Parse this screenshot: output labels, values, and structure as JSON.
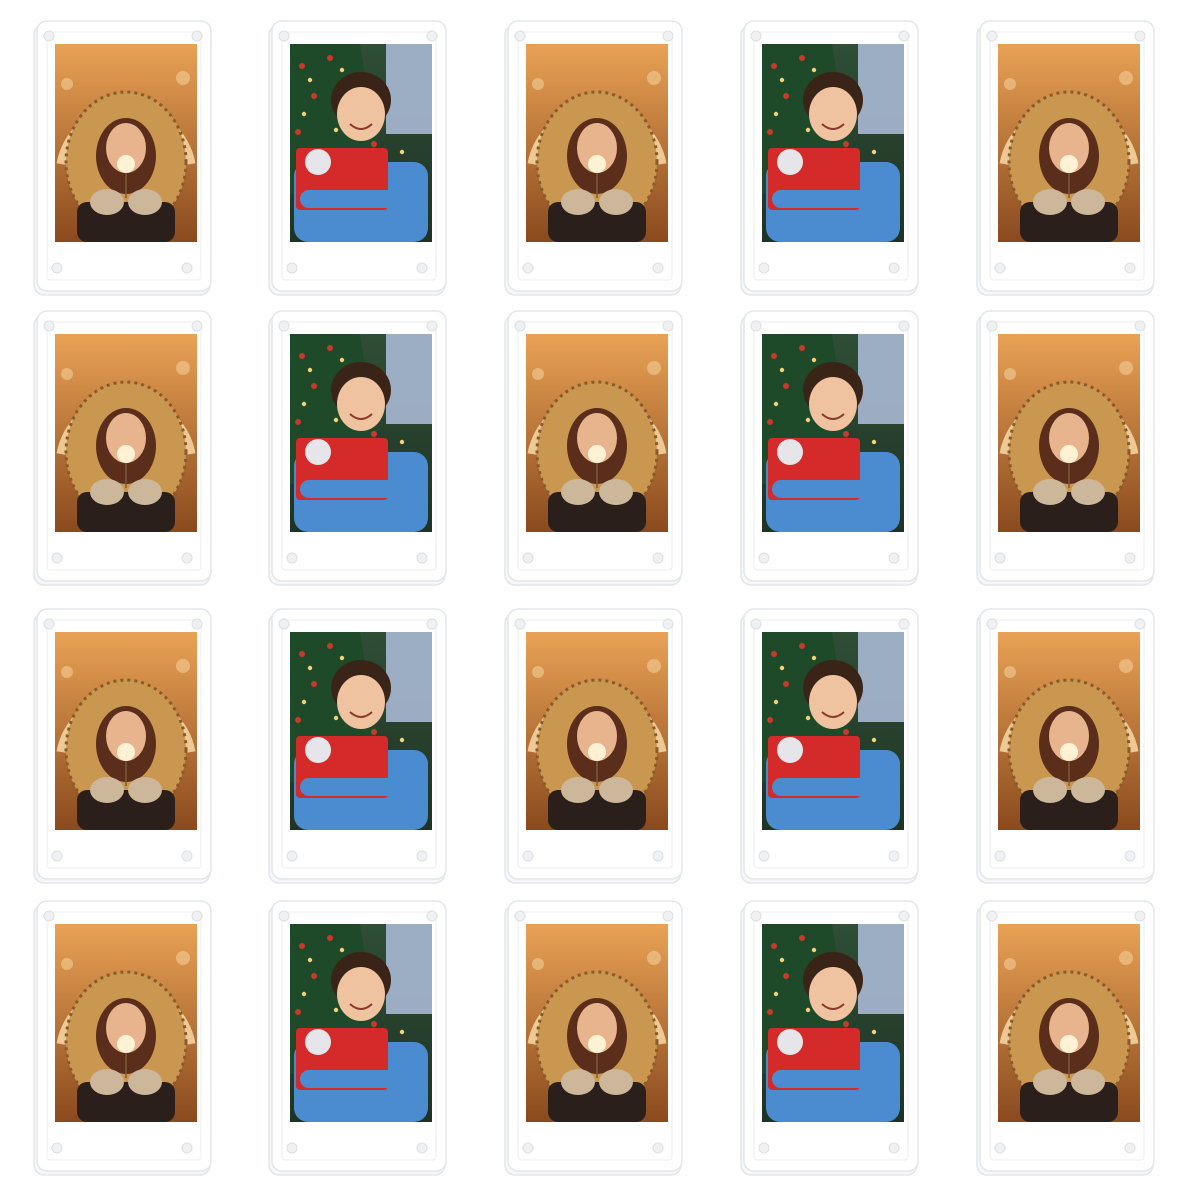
{
  "grid": {
    "rows": 4,
    "columns": 5
  },
  "colors": {
    "acrylic_edge": "#e3e6ea",
    "insert_paper": "#ffffff",
    "magnet_dot": "#f0f1f3"
  },
  "photo_pattern": [
    "girl-in-fur-hood",
    "boy-with-gift",
    "girl-in-fur-hood",
    "boy-with-gift",
    "girl-in-fur-hood"
  ],
  "photos": {
    "girl-in-fur-hood": {
      "subject": "girl-in-fur-hood",
      "colors": {
        "bg_top": "#e9a255",
        "bg_bottom": "#8a4a1e",
        "arch": "#f7d9a6",
        "fur": "#c9974f",
        "fur_dark": "#8a5a2a",
        "face": "#e8b48e",
        "hair": "#5a2e1a",
        "coat": "#2b1f1c",
        "mittens": "#cdb79a",
        "sparkler": "#fff6d8"
      }
    },
    "boy-with-gift": {
      "subject": "boy-with-gift",
      "colors": {
        "bg_top": "#2f4e36",
        "bg_bottom": "#1f3324",
        "window": "#a9b9d4",
        "tree": "#1e4a2a",
        "ornament": "#c83a2a",
        "light": "#f4d27a",
        "face": "#f0c3a0",
        "hair": "#3a2418",
        "sweater": "#4a8ccf",
        "gift": "#d42a2a",
        "bow": "#e6e6ea"
      }
    }
  }
}
